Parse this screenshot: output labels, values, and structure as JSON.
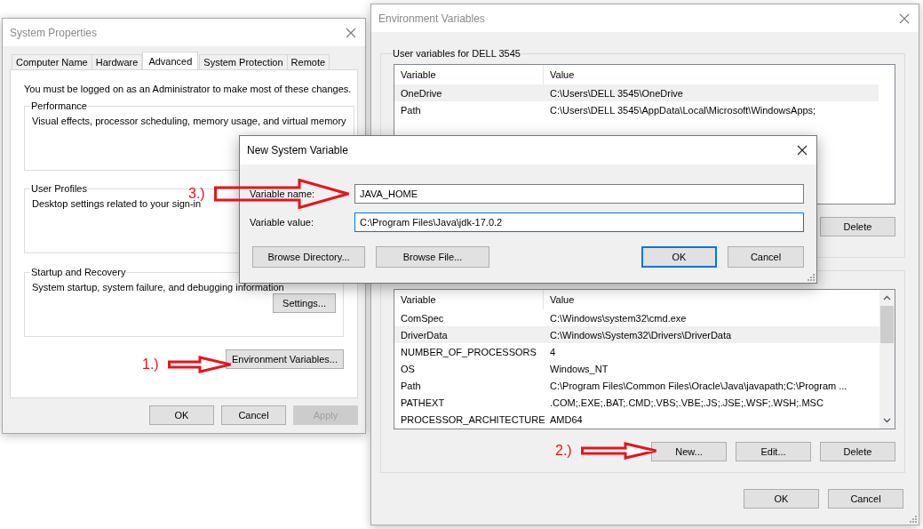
{
  "system_properties": {
    "title": "System Properties",
    "tabs": [
      {
        "label": "Computer Name",
        "selected": false
      },
      {
        "label": "Hardware",
        "selected": false
      },
      {
        "label": "Advanced",
        "selected": true
      },
      {
        "label": "System Protection",
        "selected": false
      },
      {
        "label": "Remote",
        "selected": false
      }
    ],
    "admin_note": "You must be logged on as an Administrator to make most of these changes.",
    "groups": [
      {
        "title": "Performance",
        "description": "Visual effects, processor scheduling, memory usage, and virtual memory"
      },
      {
        "title": "User Profiles",
        "description": "Desktop settings related to your sign-in"
      },
      {
        "title": "Startup and Recovery",
        "description": "System startup, system failure, and debugging information",
        "button": "Settings..."
      }
    ],
    "env_button": "Environment Variables...",
    "buttons": [
      {
        "label": "OK",
        "disabled": false
      },
      {
        "label": "Cancel",
        "disabled": false
      },
      {
        "label": "Apply",
        "disabled": true
      }
    ]
  },
  "environment_variables": {
    "title": "Environment Variables",
    "user_group": {
      "title": "User variables for DELL 3545",
      "columns": [
        "Variable",
        "Value"
      ],
      "rows": [
        {
          "variable": "OneDrive",
          "value": "C:\\Users\\DELL 3545\\OneDrive",
          "selected": true
        },
        {
          "variable": "Path",
          "value": "C:\\Users\\DELL 3545\\AppData\\Local\\Microsoft\\WindowsApps;",
          "selected": false
        }
      ],
      "buttons": [
        "Delete"
      ]
    },
    "system_group": {
      "columns": [
        "Variable",
        "Value"
      ],
      "rows": [
        {
          "variable": "ComSpec",
          "value": "C:\\Windows\\system32\\cmd.exe",
          "selected": false
        },
        {
          "variable": "DriverData",
          "value": "C:\\Windows\\System32\\Drivers\\DriverData",
          "selected": true
        },
        {
          "variable": "NUMBER_OF_PROCESSORS",
          "value": "4",
          "selected": false
        },
        {
          "variable": "OS",
          "value": "Windows_NT",
          "selected": false
        },
        {
          "variable": "Path",
          "value": "C:\\Program Files\\Common Files\\Oracle\\Java\\javapath;C:\\Program ...",
          "selected": false
        },
        {
          "variable": "PATHEXT",
          "value": ".COM;.EXE;.BAT;.CMD;.VBS;.VBE;.JS;.JSE;.WSF;.WSH;.MSC",
          "selected": false
        },
        {
          "variable": "PROCESSOR_ARCHITECTURE",
          "value": "AMD64",
          "selected": false
        }
      ],
      "buttons": [
        "New...",
        "Edit...",
        "Delete"
      ]
    },
    "buttons": [
      "OK",
      "Cancel"
    ]
  },
  "new_variable_dialog": {
    "title": "New System Variable",
    "fields": [
      {
        "label": "Variable name:",
        "value": "JAVA_HOME",
        "focused": false
      },
      {
        "label": "Variable value:",
        "value": "C:\\Program Files\\Java\\jdk-17.0.2",
        "focused": true
      }
    ],
    "buttons": [
      {
        "label": "Browse Directory...",
        "default": false
      },
      {
        "label": "Browse File...",
        "default": false
      },
      {
        "label": "OK",
        "default": true
      },
      {
        "label": "Cancel",
        "default": false
      }
    ]
  },
  "annotations": [
    {
      "label": "1.)"
    },
    {
      "label": "2.)"
    },
    {
      "label": "3.)"
    }
  ]
}
